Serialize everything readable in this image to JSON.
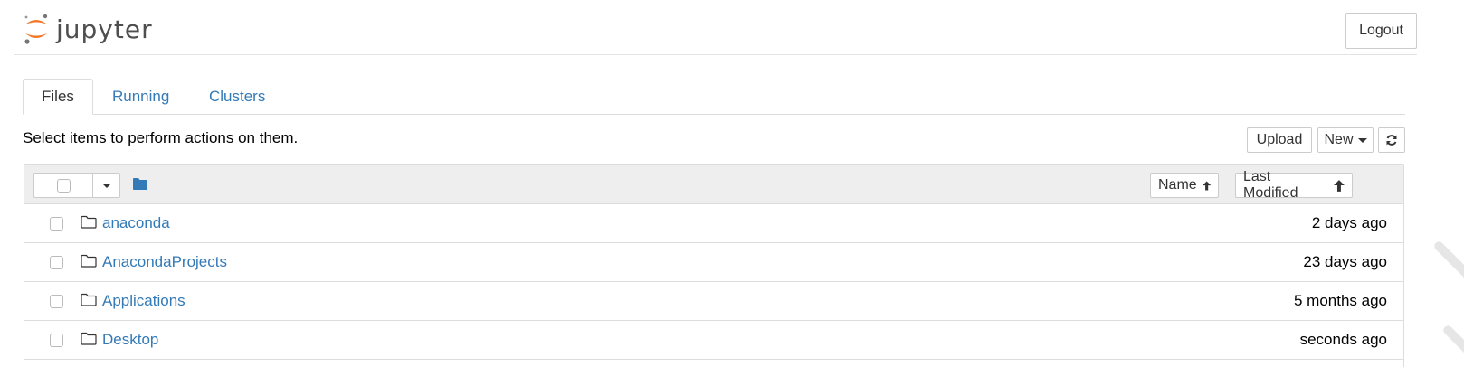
{
  "header": {
    "logo_text": "jupyter",
    "logout_label": "Logout"
  },
  "tabs": [
    {
      "label": "Files",
      "active": true
    },
    {
      "label": "Running",
      "active": false
    },
    {
      "label": "Clusters",
      "active": false
    }
  ],
  "toolbar": {
    "instructions": "Select items to perform actions on them.",
    "upload_label": "Upload",
    "new_label": "New",
    "refresh_icon": "refresh-icon"
  },
  "list": {
    "sort_name_label": "Name",
    "sort_modified_label": "Last Modified",
    "items": [
      {
        "name": "anaconda",
        "modified": "2 days ago"
      },
      {
        "name": "AnacondaProjects",
        "modified": "23 days ago"
      },
      {
        "name": "Applications",
        "modified": "5 months ago"
      },
      {
        "name": "Desktop",
        "modified": "seconds ago"
      }
    ]
  },
  "colors": {
    "link": "#337ab7",
    "logo_orange": "#f37726",
    "header_bg": "#eeeeee"
  }
}
